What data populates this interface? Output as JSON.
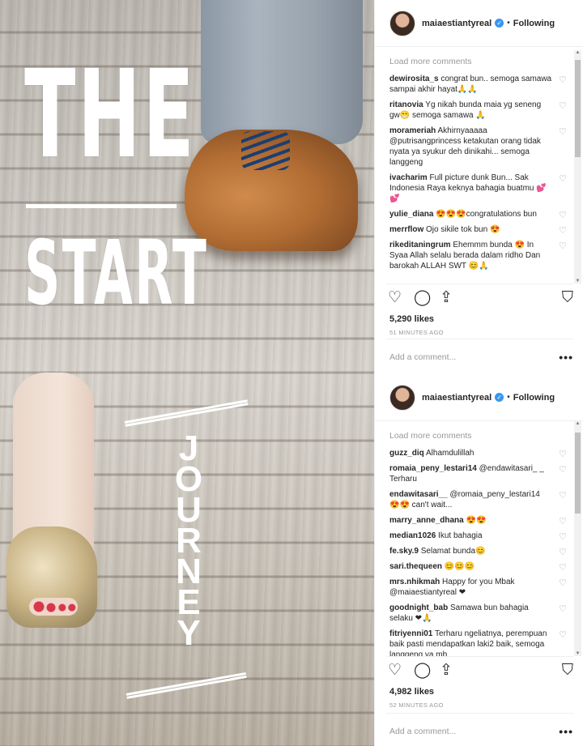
{
  "image": {
    "text_the": "THE",
    "text_start": "START",
    "text_journey": [
      "J",
      "O",
      "U",
      "R",
      "N",
      "E",
      "Y"
    ]
  },
  "posts": [
    {
      "username": "maiaestiantyreal",
      "follow_status": "Following",
      "load_more": "Load more comments",
      "comments": [
        {
          "user": "dewirosita_s",
          "text": "congrat bun.. semoga samawa sampai akhir hayat🙏🙏"
        },
        {
          "user": "ritanovia",
          "text": "Yg nikah bunda maia yg seneng gw😁 semoga samawa 🙏"
        },
        {
          "user": "morameriah",
          "text": "Akhirnyaaaaa @putrisangprincess ketakutan orang tidak nyata ya syukur deh dinikahi... semoga langgeng"
        },
        {
          "user": "ivacharim",
          "text": "Full picture dunk Bun... Sak Indonesia Raya keknya bahagia buatmu 💕💕"
        },
        {
          "user": "yulie_diana",
          "text": "😍😍😍congratulations bun"
        },
        {
          "user": "merrflow",
          "text": "Ojo sikile tok bun 😍"
        },
        {
          "user": "rikeditaningrum",
          "text": "Ehemmm bunda 😍 In Syaa Allah selalu berada dalam ridho Dan barokah ALLAH SWT 😊🙏"
        }
      ],
      "likes": "5,290 likes",
      "time": "51 MINUTES AGO",
      "add_comment_placeholder": "Add a comment...",
      "more_label": "•••"
    },
    {
      "username": "maiaestiantyreal",
      "follow_status": "Following",
      "load_more": "Load more comments",
      "comments": [
        {
          "user": "guzz_diq",
          "text": "Alhamdulillah"
        },
        {
          "user": "romaia_peny_lestari14",
          "text": "@endawitasari_ _ Terharu"
        },
        {
          "user": "endawitasari__",
          "text": "@romaia_peny_lestari14 😍😍 can't wait..."
        },
        {
          "user": "marry_anne_dhana",
          "text": "😍😍"
        },
        {
          "user": "median1026",
          "text": "Ikut bahagia"
        },
        {
          "user": "fe.sky.9",
          "text": "Selamat bunda😊"
        },
        {
          "user": "sari.thequeen",
          "text": "😊😊😊"
        },
        {
          "user": "mrs.nhikmah",
          "text": "Happy for you Mbak @maiaestiantyreal ❤"
        },
        {
          "user": "goodnight_bab",
          "text": "Samawa bun bahagia selaku ❤🙏"
        },
        {
          "user": "fitriyenni01",
          "text": "Terharu ngeliatnya, perempuan baik pasti mendapatkan laki2 baik, semoga langgeng ya mb"
        }
      ],
      "likes": "4,982 likes",
      "time": "52 MINUTES AGO",
      "add_comment_placeholder": "Add a comment...",
      "more_label": "•••"
    }
  ],
  "icons": {
    "heart": "♡",
    "comment": "◯",
    "share": "⇪",
    "bookmark": "⛉",
    "verified": "✓"
  },
  "colors": {
    "verified_blue": "#3897f0",
    "muted_text": "#999999",
    "text": "#262626"
  }
}
